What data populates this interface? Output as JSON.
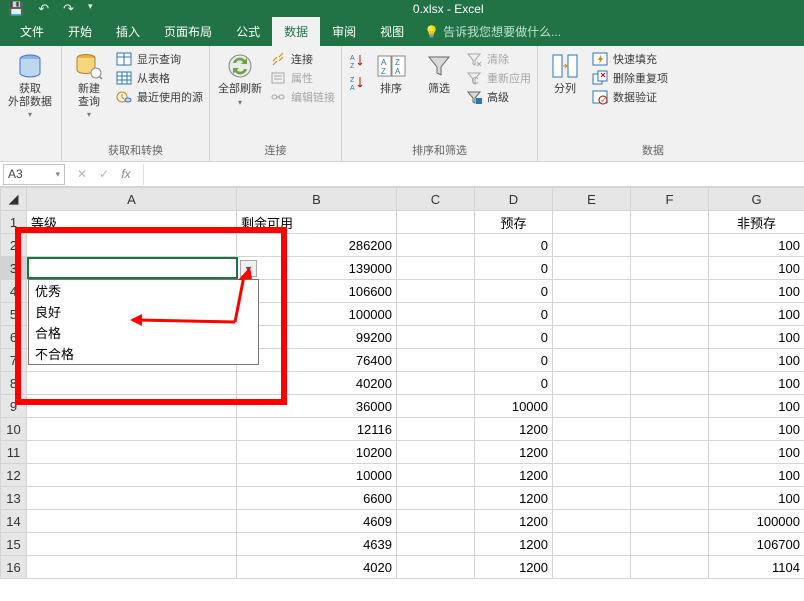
{
  "title": "0.xlsx - Excel",
  "tabs": [
    "文件",
    "开始",
    "插入",
    "页面布局",
    "公式",
    "数据",
    "审阅",
    "视图"
  ],
  "active_tab": "数据",
  "tellme": "告诉我您想要做什么...",
  "ribbon": {
    "g1": {
      "btn1": "获取\n外部数据",
      "label": ""
    },
    "g2": {
      "btn1": "新建\n查询",
      "i1": "显示查询",
      "i2": "从表格",
      "i3": "最近使用的源",
      "label": "获取和转换"
    },
    "g3": {
      "btn1": "全部刷新",
      "i1": "连接",
      "i2": "属性",
      "i3": "编辑链接",
      "label": "连接"
    },
    "g4": {
      "btn1": "排序",
      "btn2": "筛选",
      "i1": "清除",
      "i2": "重新应用",
      "i3": "高级",
      "label": "排序和筛选"
    },
    "g5": {
      "btn1": "分列",
      "i1": "快速填充",
      "i2": "删除重复项",
      "i3": "数据验证",
      "label": "数据"
    }
  },
  "namebox": "A3",
  "fx_x": "✕",
  "fx_check": "✓",
  "fx_fx": "fx",
  "cols": [
    "",
    "A",
    "B",
    "C",
    "D",
    "E",
    "F",
    "G"
  ],
  "headers": {
    "a": "等级",
    "b": "剩余可用",
    "d": "预存",
    "g": "非预存"
  },
  "rows": [
    {
      "n": 1
    },
    {
      "n": 2,
      "b": "286200",
      "d": "0",
      "g": "100"
    },
    {
      "n": 3,
      "b": "139000",
      "d": "0",
      "g": "100"
    },
    {
      "n": 4,
      "b": "106600",
      "d": "0",
      "g": "100"
    },
    {
      "n": 5,
      "b": "100000",
      "d": "0",
      "g": "100"
    },
    {
      "n": 6,
      "b": "99200",
      "d": "0",
      "g": "100"
    },
    {
      "n": 7,
      "b": "76400",
      "d": "0",
      "g": "100"
    },
    {
      "n": 8,
      "b": "40200",
      "d": "0",
      "g": "100"
    },
    {
      "n": 9,
      "b": "36000",
      "d": "10000",
      "g": "100"
    },
    {
      "n": 10,
      "b": "12116",
      "d": "1200",
      "g": "100"
    },
    {
      "n": 11,
      "b": "10200",
      "d": "1200",
      "g": "100"
    },
    {
      "n": 12,
      "b": "10000",
      "d": "1200",
      "g": "100"
    },
    {
      "n": 13,
      "b": "6600",
      "d": "1200",
      "g": "100"
    },
    {
      "n": 14,
      "b": "4609",
      "d": "1200",
      "g": "100000"
    },
    {
      "n": 15,
      "b": "4639",
      "d": "1200",
      "g": "106700"
    },
    {
      "n": 16,
      "b": "4020",
      "d": "1200",
      "g": "1104"
    }
  ],
  "dropdown": [
    "优秀",
    "良好",
    "合格",
    "不合格"
  ],
  "colors": {
    "brand": "#217346",
    "red": "#ff0000"
  }
}
